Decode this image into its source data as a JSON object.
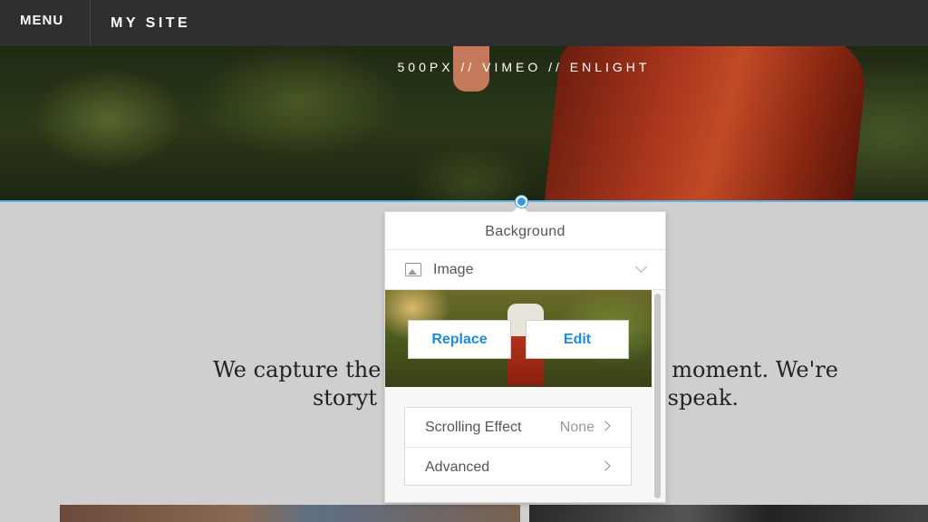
{
  "topbar": {
    "menu_label": "MENU",
    "site_name": "MY SITE"
  },
  "hero": {
    "links": "500PX  //  VIMEO  //  ENLIGHT"
  },
  "tagline": "We capture the mo               ery moment. We're storyt                     speak.",
  "panel": {
    "title": "Background",
    "type": {
      "icon": "image-icon",
      "label": "Image"
    },
    "buttons": {
      "replace": "Replace",
      "edit": "Edit"
    },
    "settings": [
      {
        "label": "Scrolling Effect",
        "value": "None"
      },
      {
        "label": "Advanced",
        "value": ""
      }
    ]
  },
  "colors": {
    "accent": "#1f8ad9",
    "selection_line": "#5fb4e6",
    "topbar": "#2f2f2f"
  }
}
